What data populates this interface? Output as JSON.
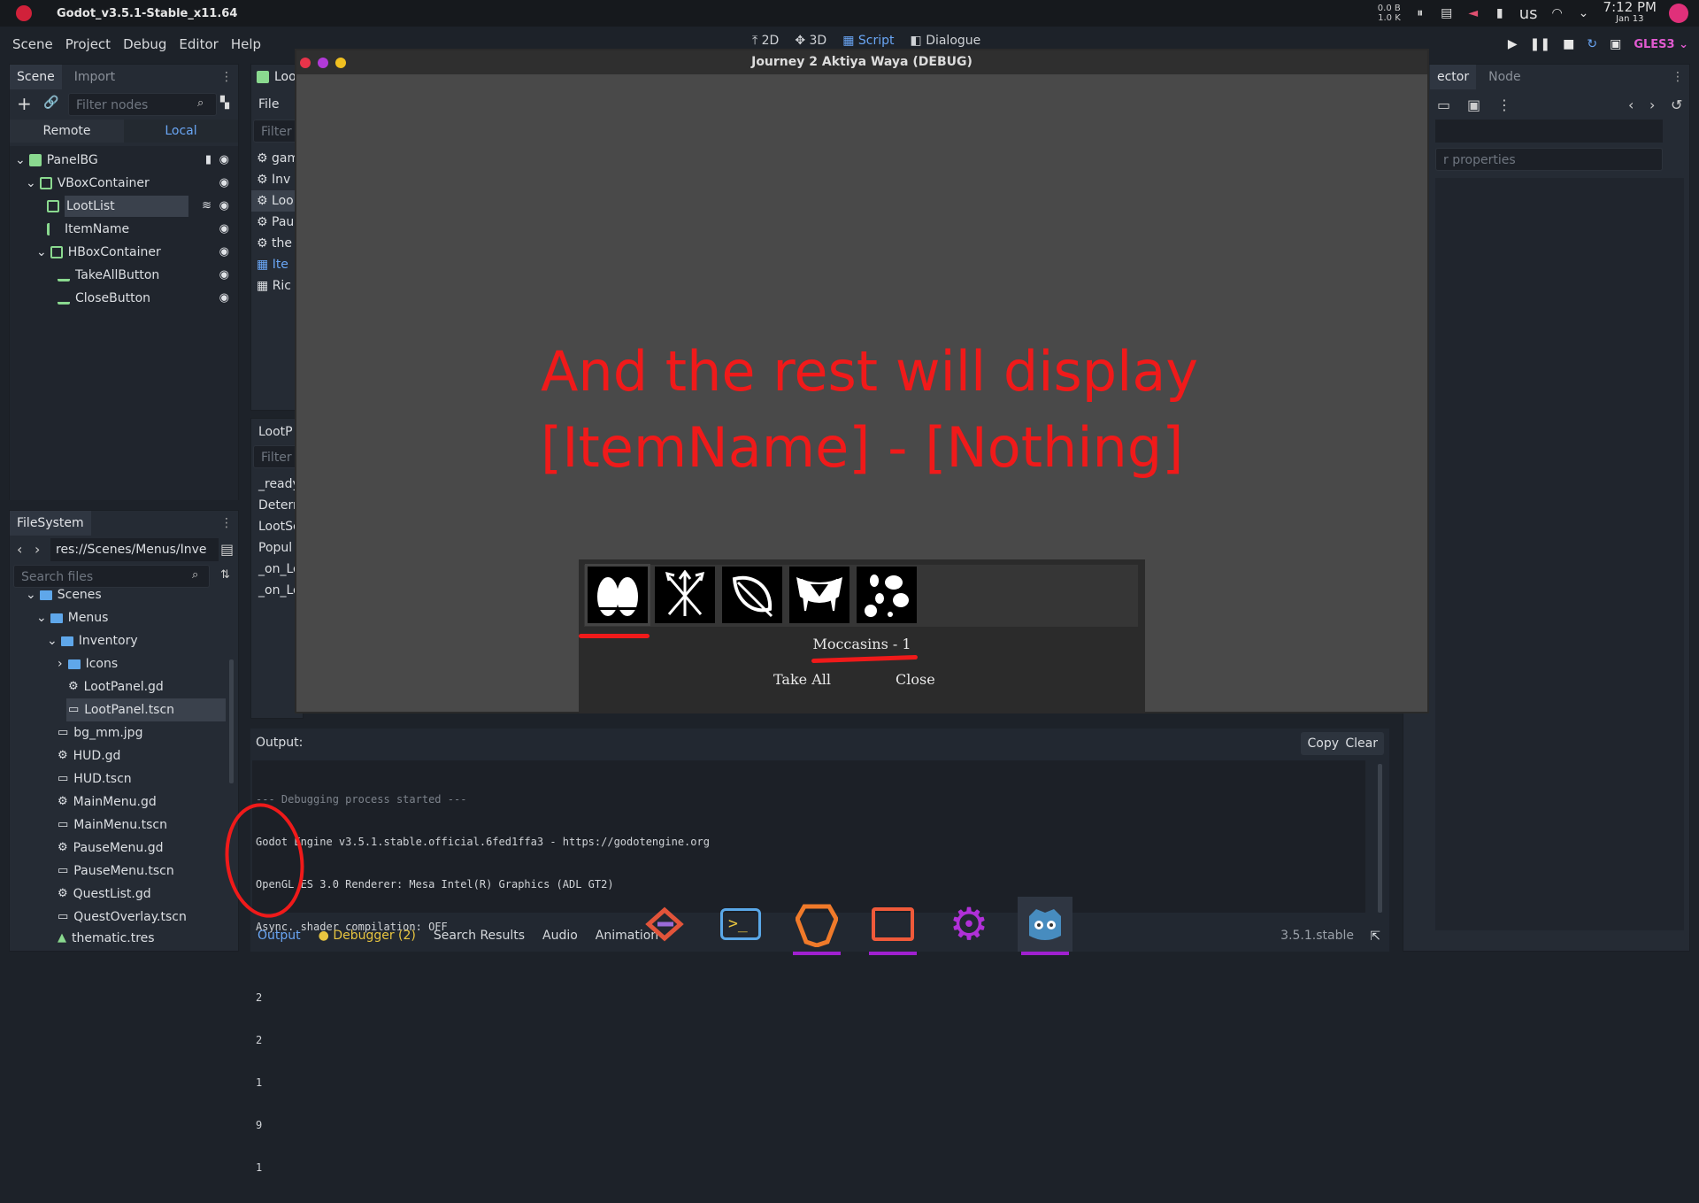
{
  "os": {
    "window_title": "Godot_v3.5.1-Stable_x11.64",
    "net_up": "0.0 B",
    "net_down": "1.0 K",
    "keyboard_layout": "us",
    "time": "7:12 PM",
    "date": "Jan 13"
  },
  "menu": {
    "items": [
      "Scene",
      "Project",
      "Debug",
      "Editor",
      "Help"
    ]
  },
  "modes": {
    "m2d": "2D",
    "m3d": "3D",
    "script": "Script",
    "dialogue": "Dialogue"
  },
  "renderer": "GLES3",
  "scene_dock": {
    "tabs": [
      "Scene",
      "Import"
    ],
    "filter_placeholder": "Filter nodes",
    "remote": "Remote",
    "local": "Local",
    "nodes": [
      "PanelBG",
      "VBoxContainer",
      "LootList",
      "ItemName",
      "HBoxContainer",
      "TakeAllButton",
      "CloseButton"
    ]
  },
  "script_panel": {
    "file_label": "File",
    "filter_label": "Filter",
    "scripts": [
      "gam",
      "Inv",
      "Loo",
      "Pau",
      "the",
      "Ite",
      "Ric"
    ],
    "methods_header": "LootP",
    "methods_filter": "Filter",
    "methods": [
      "_ready",
      "Deterr",
      "LootSe",
      "Popul",
      "_on_Lo",
      "_on_Lo"
    ]
  },
  "filesystem": {
    "title": "FileSystem",
    "path": "res://Scenes/Menus/Inve",
    "search_placeholder": "Search files",
    "entries": [
      "Scenes",
      "Menus",
      "Inventory",
      "Icons",
      "LootPanel.gd",
      "LootPanel.tscn",
      "bg_mm.jpg",
      "HUD.gd",
      "HUD.tscn",
      "MainMenu.gd",
      "MainMenu.tscn",
      "PauseMenu.gd",
      "PauseMenu.tscn",
      "QuestList.gd",
      "QuestOverlay.tscn",
      "thematic.tres"
    ]
  },
  "inspector": {
    "tabs": [
      "ector",
      "Node"
    ],
    "filter_placeholder": "r properties"
  },
  "game": {
    "title": "Journey 2 Aktiya Waya (DEBUG)",
    "overlay_line1": "And the rest will display",
    "overlay_line2": "[ItemName] - [Nothing]",
    "item_name": "Moccasins - 1",
    "take_all": "Take All",
    "close": "Close",
    "colors": {
      "annotation": "#f01a1a",
      "panel": "#2b2b2b"
    }
  },
  "output": {
    "label": "Output:",
    "copy": "Copy",
    "clear": "Clear",
    "lines": [
      "--- Debugging process started ---",
      "Godot Engine v3.5.1.stable.official.6fed1ffa3 - https://godotengine.org",
      "OpenGL ES 3.0 Renderer: Mesa Intel(R) Graphics (ADL GT2)",
      "Async. shader compilation: OFF",
      "",
      "2",
      "2",
      "1",
      "9",
      "1"
    ],
    "tabs": [
      "Output",
      "Debugger (2)",
      "Search Results",
      "Audio",
      "Animation"
    ],
    "version": "3.5.1.stable"
  }
}
